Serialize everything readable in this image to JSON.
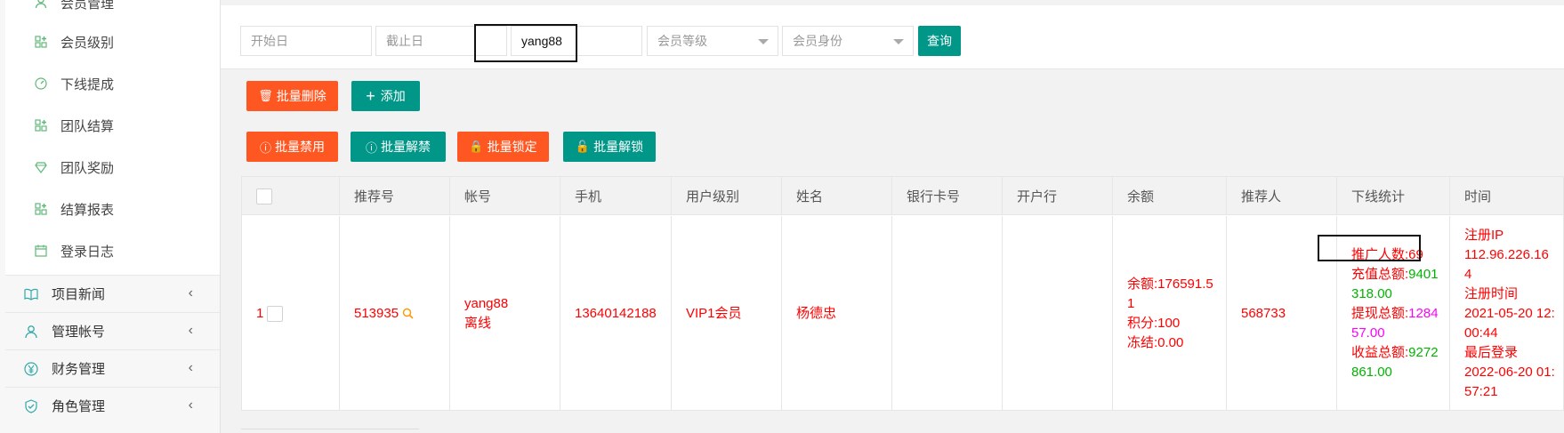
{
  "sidebar": {
    "sub_items": [
      {
        "label": "会员管理",
        "icon": "user-icon"
      },
      {
        "label": "会员级别",
        "icon": "grid-icon"
      },
      {
        "label": "下线提成",
        "icon": "gauge-icon"
      },
      {
        "label": "团队结算",
        "icon": "grid-icon"
      },
      {
        "label": "团队奖励",
        "icon": "diamond-icon"
      },
      {
        "label": "结算报表",
        "icon": "grid-icon"
      },
      {
        "label": "登录日志",
        "icon": "calendar-icon"
      }
    ],
    "menu_items": [
      {
        "label": "项目新闻",
        "icon": "book-icon"
      },
      {
        "label": "管理帐号",
        "icon": "user-icon"
      },
      {
        "label": "财务管理",
        "icon": "yen-icon"
      },
      {
        "label": "角色管理",
        "icon": "shield-icon"
      }
    ]
  },
  "filters": {
    "start_date_placeholder": "开始日",
    "end_date_placeholder": "截止日",
    "account_value": "yang88",
    "level_placeholder": "会员等级",
    "identity_placeholder": "会员身份",
    "query_label": "查询"
  },
  "actions": {
    "batch_delete": "批量删除",
    "add": "添加",
    "batch_ban": "批量禁用",
    "batch_unban": "批量解禁",
    "batch_lock": "批量锁定",
    "batch_unlock": "批量解锁"
  },
  "table": {
    "headers": [
      "推荐号",
      "帐号",
      "手机",
      "用户级别",
      "姓名",
      "银行卡号",
      "开户行",
      "余额",
      "推荐人",
      "下线统计",
      "时间"
    ],
    "row": {
      "index": "1",
      "ref_no": "513935",
      "account": "yang88",
      "status": "离线",
      "phone": "13640142188",
      "level": "VIP1会员",
      "name": "杨德忠",
      "bank_card": "",
      "bank": "",
      "balance": "余额:176591.51",
      "points": "积分:100",
      "frozen": "冻结:0.00",
      "referrer": "568733",
      "stats_promoted": "推广人数:69",
      "stats_recharge_label": "充值总额:",
      "stats_recharge_value": "9401318.00",
      "stats_withdraw_label": "提现总额:",
      "stats_withdraw_value": "128457.00",
      "stats_income_label": "收益总额:",
      "stats_income_value": "9272861.00",
      "time_ip_label": "注册IP",
      "time_ip": "112.96.226.164",
      "time_reg_label": "注册时间",
      "time_reg": "2021-05-20 12:00:44",
      "time_login_label": "最后登录",
      "time_login": "2022-06-20 01:57:21"
    }
  },
  "colors": {
    "teal": "#009688",
    "orange": "#ff5722",
    "red": "#ff0000",
    "green": "#00b400",
    "magenta": "#ff00ff"
  }
}
